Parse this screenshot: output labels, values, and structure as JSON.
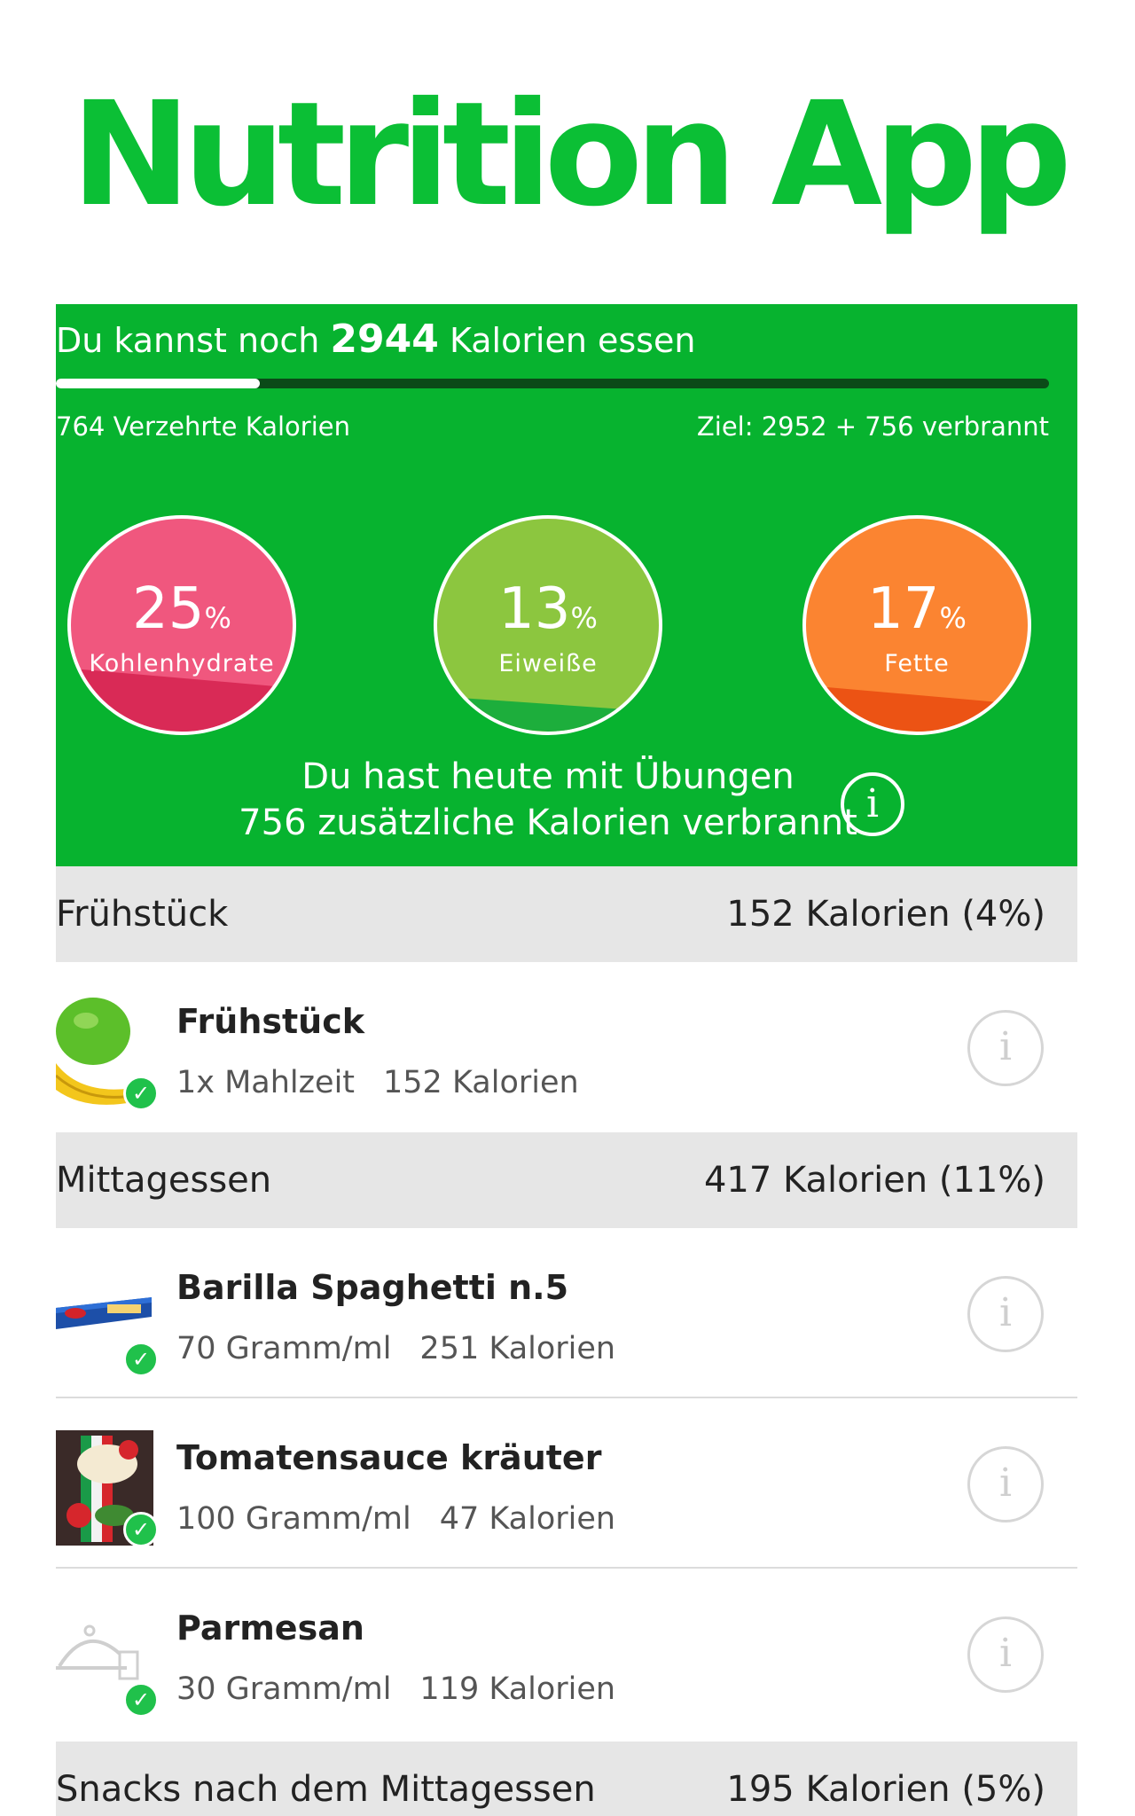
{
  "app_title": "Nutrition App",
  "summary": {
    "remaining_prefix": "Du kannst noch",
    "remaining_value": "2944",
    "remaining_suffix": "Kalorien essen",
    "consumed_text": "764 Verzehrte Kalorien",
    "goal_text": "Ziel: 2952 + 756 verbrannt",
    "progress_fraction": 0.205,
    "exercise_line1": "Du hast heute mit Übungen",
    "exercise_line2": "756 zusätzliche Kalorien verbrannt",
    "info_icon": "info-icon"
  },
  "macros": [
    {
      "value": "25",
      "unit": "%",
      "label": "Kohlenhydrate",
      "fill_fraction": 0.25,
      "color": "#f0577e",
      "fill_color": "#d92a56"
    },
    {
      "value": "13",
      "unit": "%",
      "label": "Eiweiße",
      "fill_fraction": 0.13,
      "color": "#8cc63f",
      "fill_color": "#1dae3c"
    },
    {
      "value": "17",
      "unit": "%",
      "label": "Fette",
      "fill_fraction": 0.17,
      "color": "#fb8431",
      "fill_color": "#ec5314"
    }
  ],
  "sections": [
    {
      "name": "Frühstück",
      "kcal": "152 Kalorien (4%)"
    },
    {
      "name": "Mittagessen",
      "kcal": "417 Kalorien (11%)"
    },
    {
      "name": "Snacks nach dem Mittagessen",
      "kcal": "195 Kalorien (5%)"
    }
  ],
  "foods": [
    {
      "name": "Frühstück",
      "qty": "1x Mahlzeit",
      "kcal": "152 Kalorien",
      "thumb": "apple-banana-icon"
    },
    {
      "name": "Barilla Spaghetti n.5",
      "qty": "70 Gramm/ml",
      "kcal": "251 Kalorien",
      "thumb": "pasta-package-icon"
    },
    {
      "name": "Tomatensauce kräuter",
      "qty": "100 Gramm/ml",
      "kcal": "47 Kalorien",
      "thumb": "sauce-jar-icon"
    },
    {
      "name": "Parmesan",
      "qty": "30 Gramm/ml",
      "kcal": "119 Kalorien",
      "thumb": "food-cloche-icon"
    }
  ],
  "colors": {
    "brand_green": "#0bbf35",
    "summary_green": "#07b32f",
    "check_green": "#20c14b",
    "section_gray": "#e6e6e6"
  }
}
